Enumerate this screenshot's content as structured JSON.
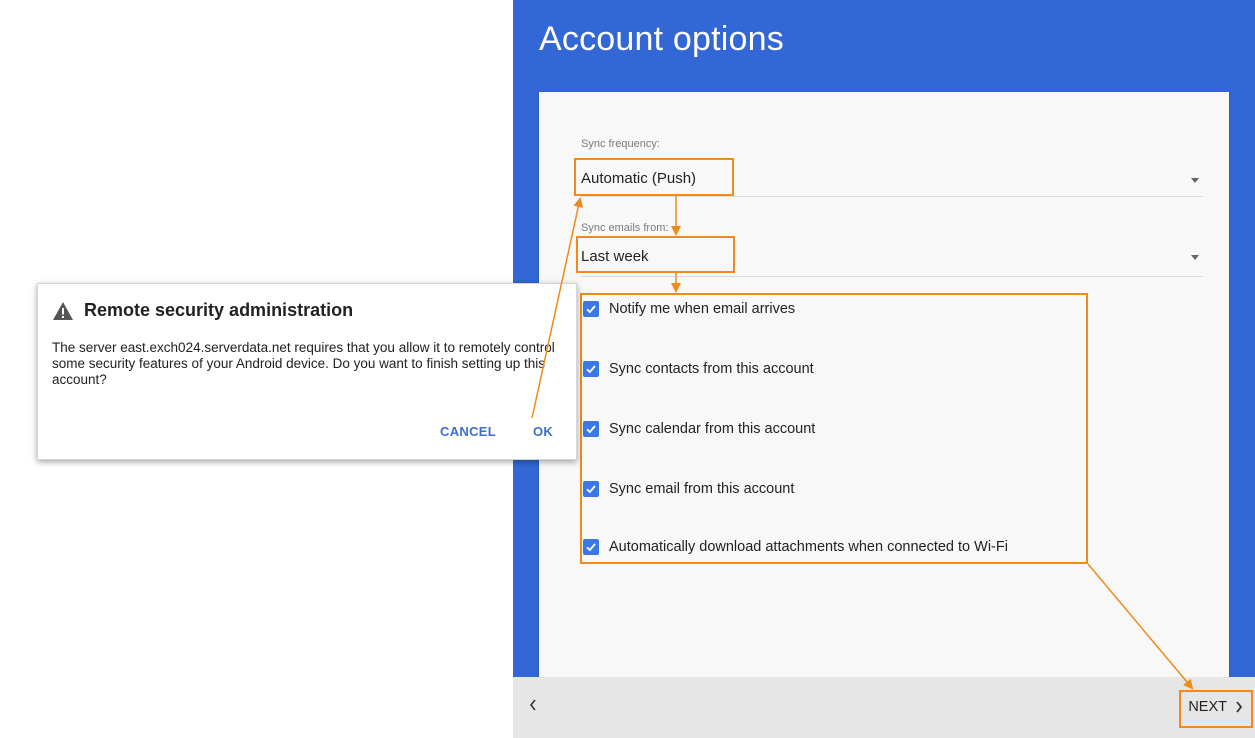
{
  "screen": {
    "title": "Account options",
    "sync_frequency": {
      "label": "Sync frequency:",
      "value": "Automatic (Push)"
    },
    "sync_emails_from": {
      "label": "Sync emails from:",
      "value": "Last week"
    },
    "options": [
      {
        "label": "Notify me when email arrives",
        "checked": true
      },
      {
        "label": "Sync contacts from this account",
        "checked": true
      },
      {
        "label": "Sync calendar from this account",
        "checked": true
      },
      {
        "label": "Sync email from this account",
        "checked": true
      },
      {
        "label": "Automatically download attachments when connected to Wi-Fi",
        "checked": true
      }
    ],
    "footer": {
      "back_icon": "chevron-left-icon",
      "next_label": "NEXT",
      "next_icon": "chevron-right-icon"
    }
  },
  "dialog": {
    "icon": "warning-icon",
    "title": "Remote security administration",
    "body": "The server east.exch024.serverdata.net requires that you allow it to remotely control some security features of your Android device. Do you want to finish setting up this account?",
    "cancel_label": "CANCEL",
    "ok_label": "OK"
  },
  "colors": {
    "primary_blue": "#3367d6",
    "highlight_orange": "#ef8a1c",
    "checkbox_blue": "#3b78e7",
    "dialog_button_blue": "#3b6fd1"
  }
}
